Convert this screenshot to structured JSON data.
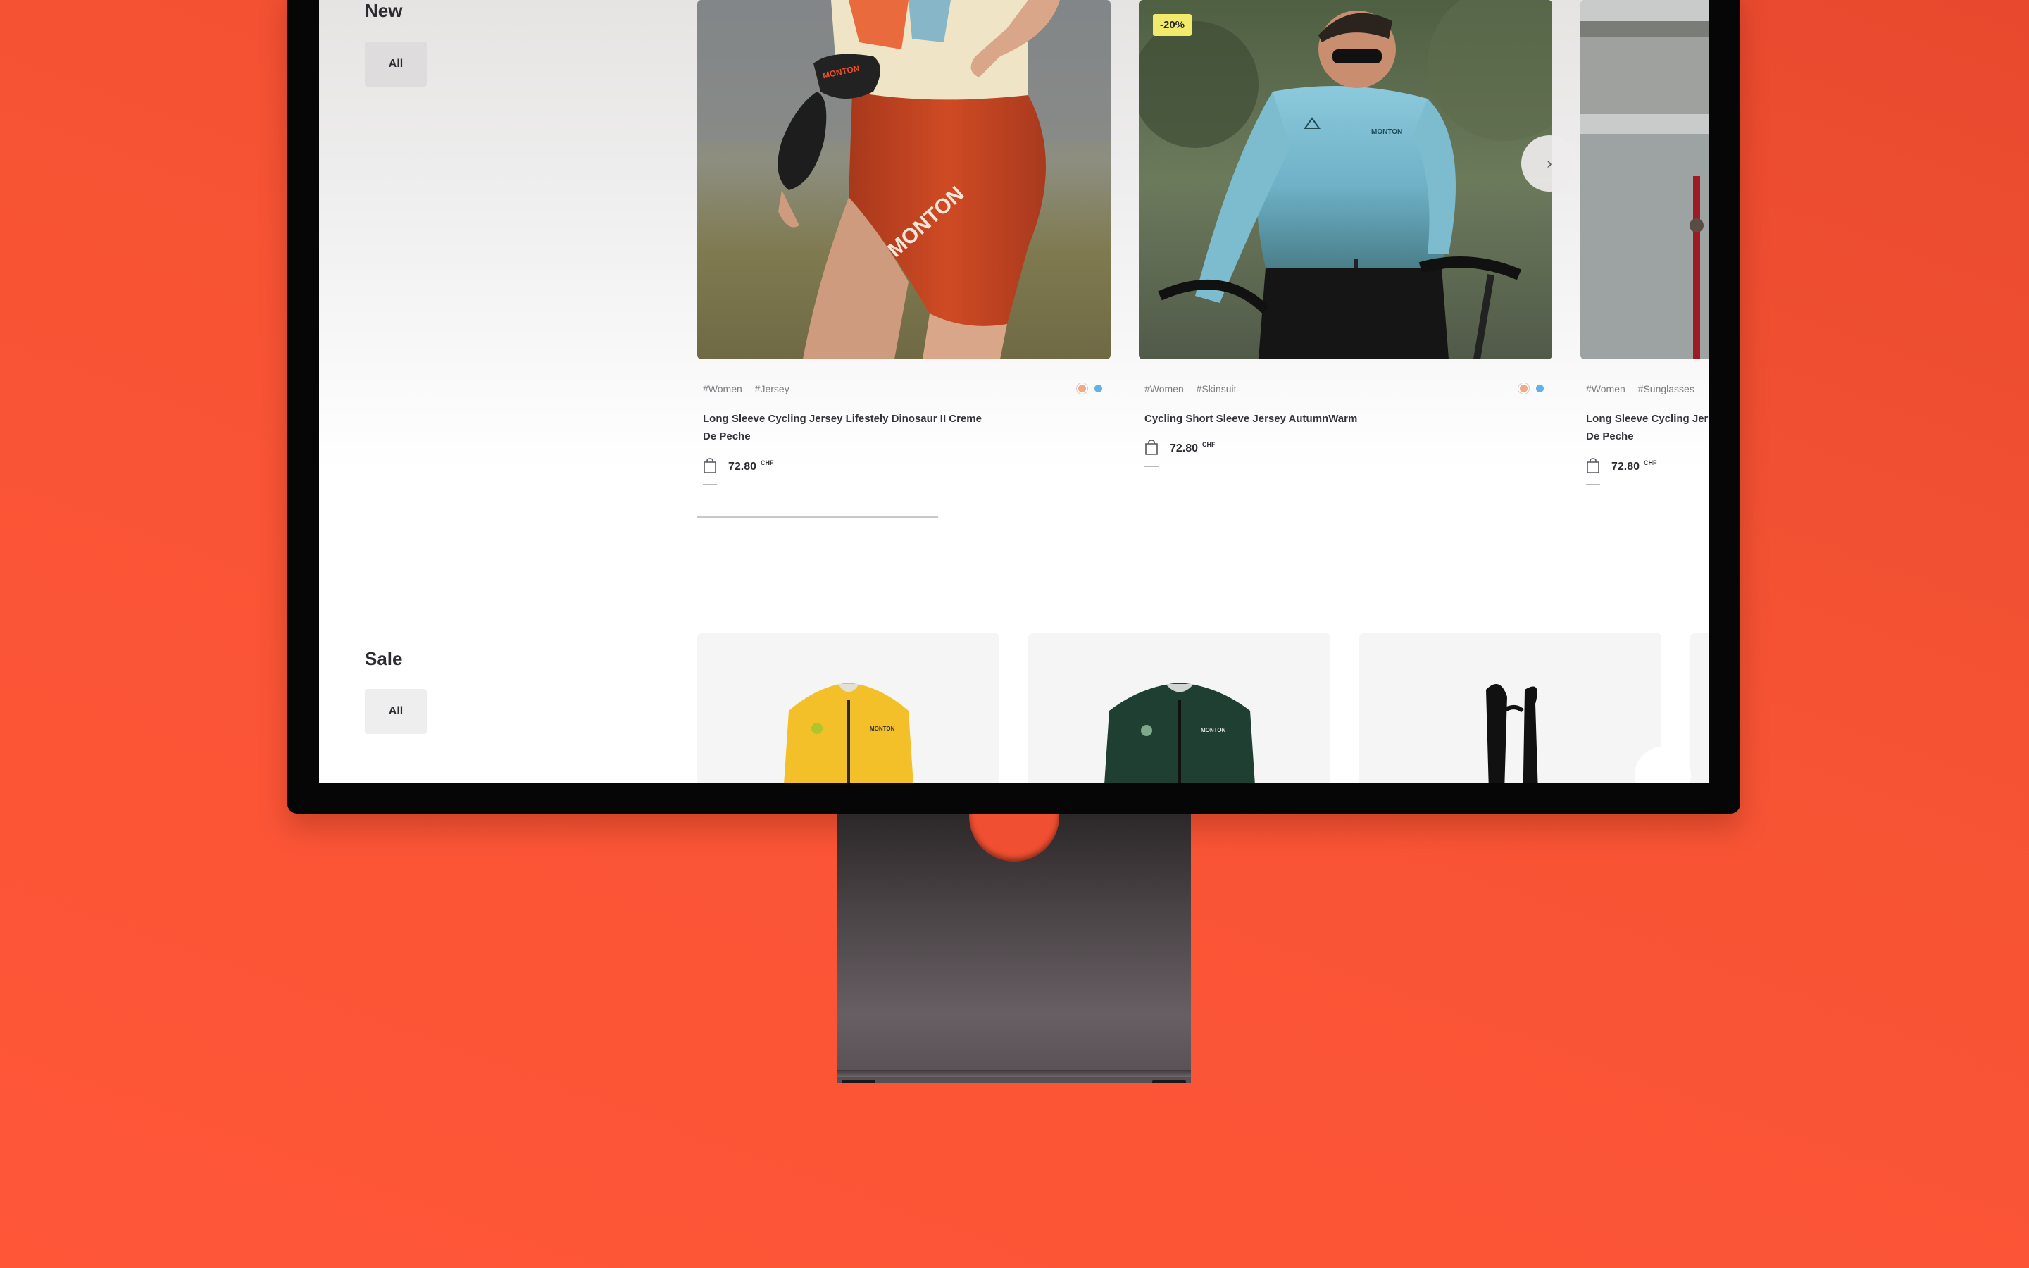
{
  "new_section": {
    "title": "New",
    "filter_label": "All",
    "products": [
      {
        "tags": [
          "#Women",
          "#Jersey"
        ],
        "name": "Long Sleeve Cycling Jersey Lifestely Dinosaur II Creme De Peche",
        "price": "72.80",
        "currency": "CHF",
        "badge": "",
        "brand_print": "MONTON",
        "swatches": [
          "#f3a987",
          "#5fb4e6"
        ]
      },
      {
        "tags": [
          "#Women",
          "#Skinsuit"
        ],
        "name": "Cycling Short Sleeve Jersey AutumnWarm",
        "price": "72.80",
        "currency": "CHF",
        "badge": "-20%",
        "brand_print": "MONTON",
        "swatches": [
          "#f3a987",
          "#5fb4e6"
        ]
      },
      {
        "tags": [
          "#Women",
          "#Sunglasses"
        ],
        "name": "Long Sleeve Cycling Jersey Lifestely Dinosaur II Creme De Peche",
        "price": "72.80",
        "currency": "CHF",
        "badge": ""
      }
    ],
    "next_icon": "chevron-right-icon"
  },
  "sale_section": {
    "title": "Sale",
    "filter_label": "All",
    "products": [
      {
        "product": "yellow long sleeve jersey"
      },
      {
        "product": "dark green long sleeve jersey"
      },
      {
        "product": "black bib straps"
      }
    ]
  },
  "colors": {
    "background": "#ff5638",
    "accent_badge": "#f2ea6a",
    "text_dark": "#2b2b31"
  }
}
